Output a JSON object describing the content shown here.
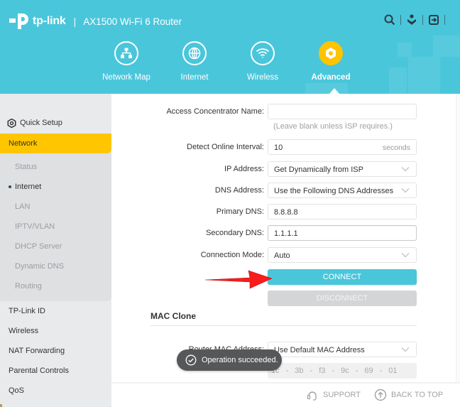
{
  "header": {
    "brand": "tp-link",
    "separator": "|",
    "model": "AX1500 Wi-Fi 6 Router",
    "top_icons": [
      "search-icon",
      "download-app-icon",
      "logout-icon"
    ],
    "accent_color": "#4ac6db",
    "active_color": "#ffc300"
  },
  "nav": {
    "items": [
      {
        "label": "Network Map",
        "icon": "network-map-icon",
        "active": false
      },
      {
        "label": "Internet",
        "icon": "globe-icon",
        "active": false
      },
      {
        "label": "Wireless",
        "icon": "wifi-icon",
        "active": false
      },
      {
        "label": "Advanced",
        "icon": "advanced-gear-icon",
        "active": true
      }
    ]
  },
  "sidebar": {
    "quick_setup": "Quick Setup",
    "network": "Network",
    "network_sub": [
      {
        "label": "Status",
        "current": false
      },
      {
        "label": "Internet",
        "current": true
      },
      {
        "label": "LAN",
        "current": false
      },
      {
        "label": "IPTV/VLAN",
        "current": false
      },
      {
        "label": "DHCP Server",
        "current": false
      },
      {
        "label": "Dynamic DNS",
        "current": false
      },
      {
        "label": "Routing",
        "current": false
      }
    ],
    "main_items": [
      "TP-Link ID",
      "Wireless",
      "NAT Forwarding",
      "Parental Controls",
      "QoS"
    ]
  },
  "form": {
    "access_concentrator": {
      "label": "Access Concentrator Name:",
      "value": "",
      "hint": "(Leave blank unless ISP requires.)"
    },
    "detect_interval": {
      "label": "Detect Online Interval:",
      "value": "10",
      "suffix": "seconds"
    },
    "ip_address": {
      "label": "IP Address:",
      "value": "Get Dynamically from ISP"
    },
    "dns_address": {
      "label": "DNS Address:",
      "value": "Use the Following DNS Addresses"
    },
    "primary_dns": {
      "label": "Primary DNS:",
      "value": "8.8.8.8"
    },
    "secondary_dns": {
      "label": "Secondary DNS:",
      "value": "1.1.1.1"
    },
    "connection_mode": {
      "label": "Connection Mode:",
      "value": "Auto"
    },
    "connect_label": "CONNECT",
    "disconnect_label": "DISCONNECT"
  },
  "mac_clone": {
    "title": "MAC Clone",
    "router_mac_label": "Router MAC Address:",
    "router_mac_value": "Use Default MAC Address",
    "mac_octets": [
      "1c",
      "-",
      "3b",
      "-",
      "f3",
      "-",
      "9c",
      "-",
      "69",
      "-",
      "01"
    ]
  },
  "toast": {
    "message": "Operation succeeded."
  },
  "footer": {
    "support": "SUPPORT",
    "back_to_top": "BACK TO TOP"
  }
}
